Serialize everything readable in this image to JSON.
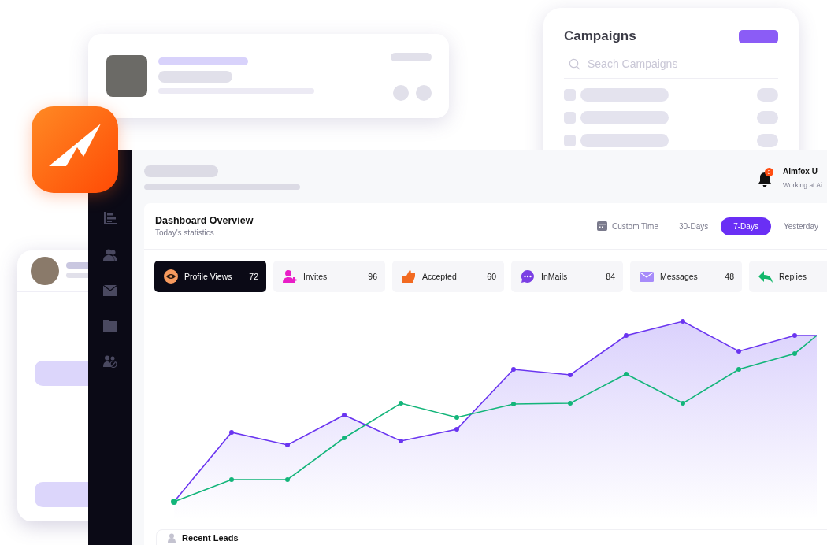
{
  "campaigns_card": {
    "title": "Campaigns",
    "search": {
      "placeholder": "Seach Campaigns"
    }
  },
  "dashboard": {
    "user": {
      "name": "Aimfox U",
      "subtitle": "Working at Ai"
    },
    "notifications": {
      "count": "3"
    },
    "overview": {
      "title": "Dashboard Overview",
      "subtitle": "Today's statistics",
      "filters": [
        {
          "label": "Custom Time",
          "kind": "custom",
          "selected": false
        },
        {
          "label": "30-Days",
          "kind": "preset",
          "selected": false
        },
        {
          "label": "7-Days",
          "kind": "preset",
          "selected": true
        },
        {
          "label": "Yesterday",
          "kind": "preset",
          "selected": false
        }
      ],
      "stats": [
        {
          "label": "Profile Views",
          "value": "72",
          "kind": "views",
          "selected": true
        },
        {
          "label": "Invites",
          "value": "96",
          "kind": "invites",
          "selected": false
        },
        {
          "label": "Accepted",
          "value": "60",
          "kind": "accepted",
          "selected": false
        },
        {
          "label": "InMails",
          "value": "84",
          "kind": "inmails",
          "selected": false
        },
        {
          "label": "Messages",
          "value": "48",
          "kind": "messages",
          "selected": false
        },
        {
          "label": "Replies",
          "kind": "replies",
          "selected": false
        }
      ]
    },
    "recent_leads": {
      "title": "Recent Leads"
    }
  }
}
